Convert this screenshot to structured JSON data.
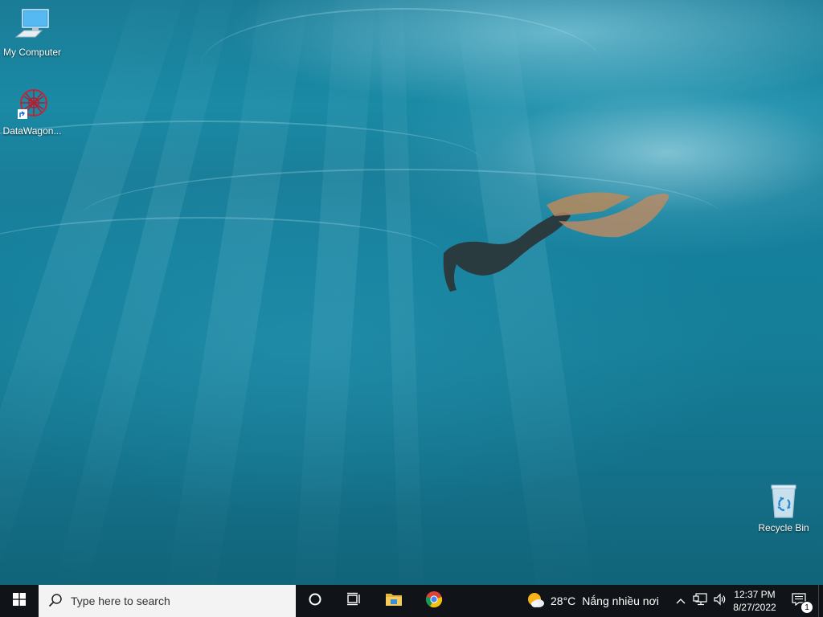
{
  "desktop": {
    "icons": [
      {
        "label": "My Computer",
        "icon": "monitor-icon"
      },
      {
        "label": "DataWagon...",
        "icon": "datawagon-icon"
      },
      {
        "label": "Recycle Bin",
        "icon": "recycle-bin-icon"
      }
    ]
  },
  "taskbar": {
    "start_icon": "windows-logo-icon",
    "search_placeholder": "Type here to search",
    "pinned": [
      "cortana-icon",
      "task-view-icon",
      "file-explorer-icon",
      "chrome-icon"
    ],
    "weather": {
      "temp": "28°C",
      "condition": "Nắng nhiều nơi",
      "icon": "sun-cloud-icon"
    },
    "clock": {
      "time": "12:37 PM",
      "date": "8/27/2022"
    },
    "notification_count": "1"
  },
  "colors": {
    "taskbar_bg": "#101418",
    "search_bg": "#f3f3f3"
  }
}
